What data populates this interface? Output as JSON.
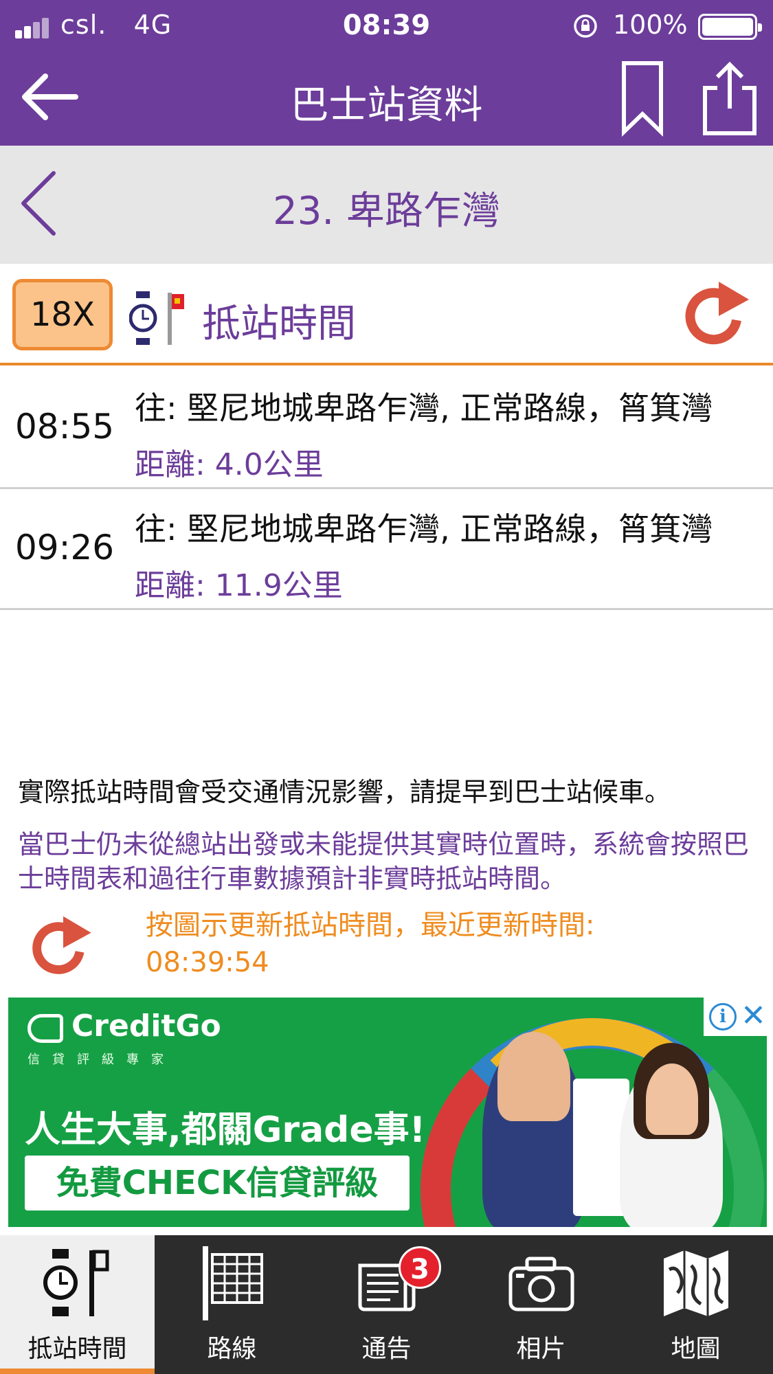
{
  "status_bar": {
    "carrier": "csl.",
    "network": "4G",
    "time": "08:39",
    "battery": "100%"
  },
  "nav": {
    "title": "巴士站資料"
  },
  "stop": {
    "name": "23. 卑路乍灣"
  },
  "route": {
    "number": "18X",
    "section_title": "抵站時間"
  },
  "etas": [
    {
      "time": "08:55",
      "destination": "往: 堅尼地城卑路乍灣, 正常路線，筲箕灣",
      "distance": "距離: 4.0公里"
    },
    {
      "time": "09:26",
      "destination": "往: 堅尼地城卑路乍灣, 正常路線，筲箕灣",
      "distance": "距離: 11.9公里"
    }
  ],
  "notes": {
    "traffic": "實際抵站時間會受交通情況影響，請提早到巴士站候車。",
    "scheduled": "當巴士仍未從總站出發或未能提供其實時位置時，系統會按照巴士時間表和過往行車數據預計非實時抵站時間。",
    "update_label": "按圖示更新抵站時間，最近更新時間:",
    "update_time": "08:39:54"
  },
  "ad": {
    "brand": "CreditGo",
    "tagline": "信貸評級專家",
    "headline": "人生大事,都關Grade事!",
    "cta": "免費CHECK信貸評級"
  },
  "tabs": [
    {
      "label": "抵站時間",
      "icon": "watch-stop-icon",
      "active": true
    },
    {
      "label": "路線",
      "icon": "route-grid-icon",
      "active": false
    },
    {
      "label": "通告",
      "icon": "notice-icon",
      "active": false,
      "badge": "3"
    },
    {
      "label": "相片",
      "icon": "camera-icon",
      "active": false
    },
    {
      "label": "地圖",
      "icon": "map-icon",
      "active": false
    }
  ],
  "colors": {
    "brand_purple": "#6c3d9a",
    "accent_orange": "#ee8a33",
    "refresh_red": "#d9533f",
    "ad_green": "#16a045"
  }
}
